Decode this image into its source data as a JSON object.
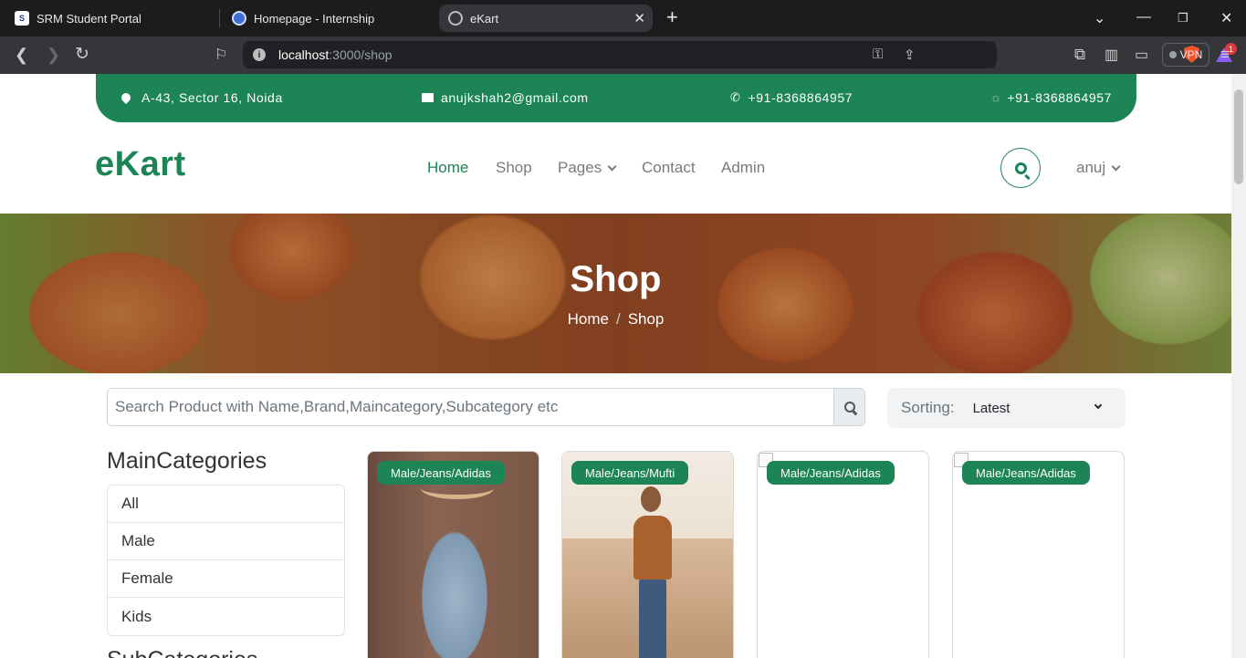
{
  "browser": {
    "tabs": [
      {
        "title": "SRM Student Portal",
        "icon": "srm-icon"
      },
      {
        "title": "Homepage - Internship",
        "icon": "homepage-icon"
      },
      {
        "title": "eKart",
        "icon": "globe-icon",
        "active": true
      }
    ],
    "url_host": "localhost",
    "url_path": ":3000/shop",
    "rewards_badge": "1",
    "vpn_label": "VPN"
  },
  "topbar": {
    "address": "A-43, Sector 16, Noida",
    "email": "anujkshah2@gmail.com",
    "phone": "+91-8368864957",
    "whatsapp": "+91-8368864957"
  },
  "navbar": {
    "logo": "eKart",
    "links": [
      {
        "label": "Home",
        "active": true
      },
      {
        "label": "Shop"
      },
      {
        "label": "Pages",
        "dropdown": true
      },
      {
        "label": "Contact"
      },
      {
        "label": "Admin"
      }
    ],
    "user": "anuj"
  },
  "hero": {
    "title": "Shop",
    "breadcrumb": [
      "Home",
      "Shop"
    ]
  },
  "search": {
    "placeholder": "Search Product with Name,Brand,Maincategory,Subcategory etc",
    "value": ""
  },
  "sorting": {
    "label": "Sorting:",
    "selected": "Latest"
  },
  "sidebar": {
    "main_title": "MainCategories",
    "main_categories": [
      "All",
      "Male",
      "Female",
      "Kids"
    ],
    "sub_title": "SubCategories"
  },
  "products": [
    {
      "badge": "Male/Jeans/Adidas"
    },
    {
      "badge": "Male/Jeans/Mufti"
    },
    {
      "badge": "Male/Jeans/Adidas"
    },
    {
      "badge": "Male/Jeans/Adidas"
    }
  ],
  "colors": {
    "brand": "#1c8455"
  }
}
